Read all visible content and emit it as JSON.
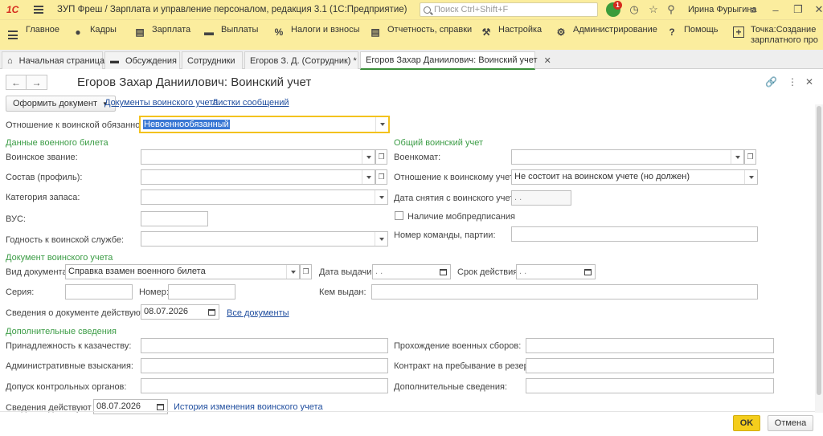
{
  "app": {
    "logo_text": "1С",
    "title": "ЗУП Фреш / Зарплата и управление персоналом, редакция 3.1  (1С:Предприятие)",
    "search_placeholder": "Поиск Ctrl+Shift+F",
    "notification_count": "1",
    "user_name": "Ирина Фурыгина"
  },
  "menu": {
    "items": [
      {
        "label": "Главное",
        "icon": "home-list-icon"
      },
      {
        "label": "Кадры",
        "icon": "people-icon"
      },
      {
        "label": "Зарплата",
        "icon": "document-icon"
      },
      {
        "label": "Выплаты",
        "icon": "wallet-icon"
      },
      {
        "label": "Налоги и взносы",
        "icon": "percent-icon"
      },
      {
        "label": "Отчетность, справки",
        "icon": "report-icon"
      },
      {
        "label": "Настройка",
        "icon": "wrench-icon"
      },
      {
        "label": "Администрирование",
        "icon": "gears-icon"
      },
      {
        "label": "Помощь",
        "icon": "question-icon"
      },
      {
        "label": "Точка:Создание зарплатного про",
        "icon": "plus-icon"
      }
    ]
  },
  "tabs": [
    {
      "label": "Начальная страница"
    },
    {
      "label": "Обсуждения"
    },
    {
      "label": "Сотрудники"
    },
    {
      "label": "Егоров З. Д. (Сотрудник) *"
    },
    {
      "label": "Егоров Захар Даниилович: Воинский учет"
    }
  ],
  "form": {
    "title": "Егоров Захар Даниилович: Воинский учет",
    "toolbar": {
      "create_doc": "Оформить документ",
      "link_docs": "Документы воинского учета",
      "link_sheets": "Листки сообщений"
    },
    "relation": {
      "label": "Отношение к воинской обязанности:",
      "value": "Невоеннообязанный"
    },
    "military_id": {
      "section": "Данные военного билета",
      "rank_label": "Воинское звание:",
      "rank_value": "",
      "staff_label": "Состав (профиль):",
      "staff_value": "",
      "reserve_label": "Категория запаса:",
      "reserve_value": "",
      "vus_label": "ВУС:",
      "vus_value": "",
      "fitness_label": "Годность к воинской службе:",
      "fitness_value": ""
    },
    "general": {
      "section": "Общий воинский учет",
      "office_label": "Военкомат:",
      "office_value": "",
      "relation_label": "Отношение к воинскому учету:",
      "relation_value": "Не состоит на воинском учете (но должен)",
      "removal_label": "Дата снятия с воинского учета:",
      "removal_value": " .  .",
      "mob_label": "Наличие мобпредписания",
      "team_label": "Номер команды, партии:",
      "team_value": ""
    },
    "doc": {
      "section": "Документ воинского учета",
      "kind_label": "Вид документа:",
      "kind_value": "Справка взамен военного билета",
      "issue_date_label": "Дата выдачи:",
      "issue_date_value": " .  .",
      "expiry_label": "Срок действия:",
      "expiry_value": " .  .",
      "series_label": "Серия:",
      "series_value": "",
      "number_label": "Номер:",
      "number_value": "",
      "issuer_label": "Кем выдан:",
      "issuer_value": "",
      "valid_from_label": "Сведения о документе действуют с:",
      "valid_from_value": "08.07.2026",
      "all_docs_link": "Все документы"
    },
    "extra": {
      "section": "Дополнительные сведения",
      "cossack_label": "Принадлежность к казачеству:",
      "cossack_value": "",
      "training_label": "Прохождение военных сборов:",
      "training_value": "",
      "penalty_label": "Административные взыскания:",
      "penalty_value": "",
      "contract_label": "Контракт на пребывание в резерве:",
      "contract_value": "",
      "access_label": "Допуск контрольных органов:",
      "access_value": "",
      "additional_label": "Дополнительные сведения:",
      "additional_value": ""
    },
    "footer": {
      "valid_label": "Сведения действуют с:",
      "valid_value": "08.07.2026",
      "history_link": "История изменения воинского учета",
      "ok": "OK",
      "cancel": "Отмена"
    }
  }
}
